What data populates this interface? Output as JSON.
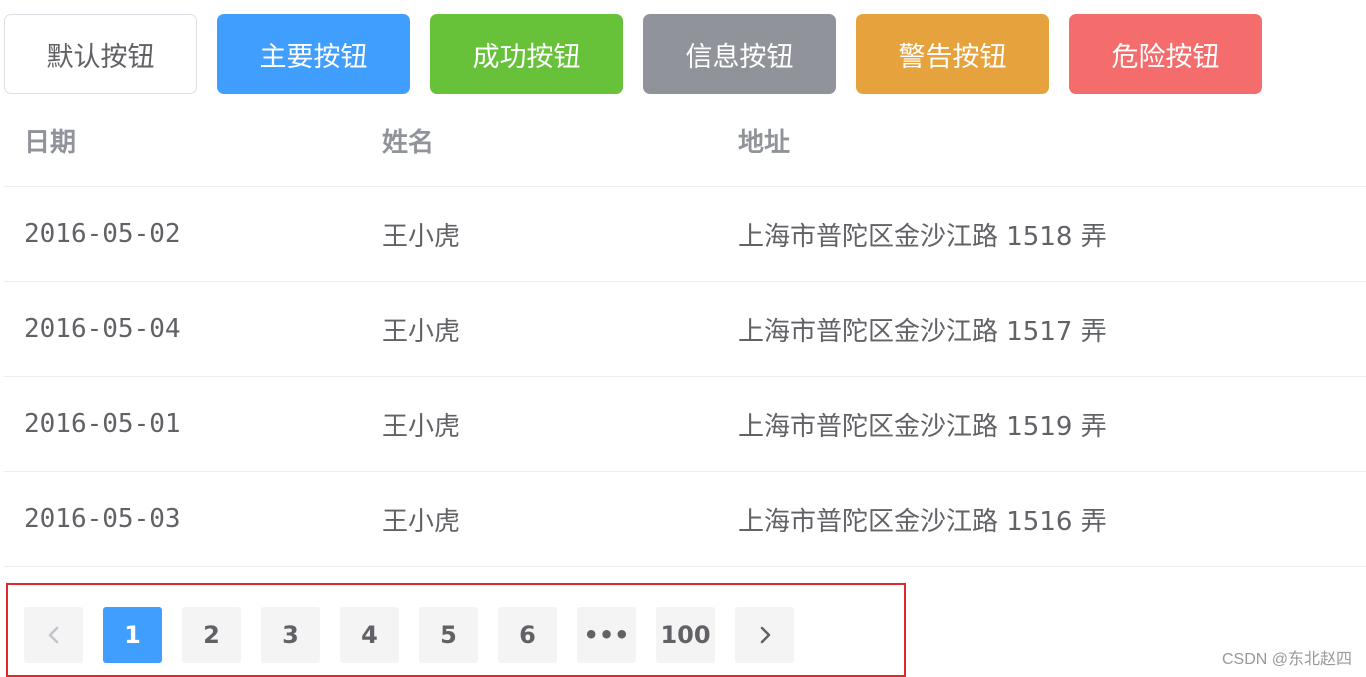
{
  "buttons": {
    "default": "默认按钮",
    "primary": "主要按钮",
    "success": "成功按钮",
    "info": "信息按钮",
    "warning": "警告按钮",
    "danger": "危险按钮"
  },
  "colors": {
    "primary": "#409eff",
    "success": "#67c23a",
    "info": "#909399",
    "warning": "#e6a23c",
    "danger": "#f56c6c",
    "highlight_border": "#e3262a"
  },
  "table": {
    "headers": [
      "日期",
      "姓名",
      "地址"
    ],
    "rows": [
      [
        "2016-05-02",
        "王小虎",
        "上海市普陀区金沙江路 1518 弄"
      ],
      [
        "2016-05-04",
        "王小虎",
        "上海市普陀区金沙江路 1517 弄"
      ],
      [
        "2016-05-01",
        "王小虎",
        "上海市普陀区金沙江路 1519 弄"
      ],
      [
        "2016-05-03",
        "王小虎",
        "上海市普陀区金沙江路 1516 弄"
      ]
    ]
  },
  "pagination": {
    "prev_icon": "chevron-left-icon",
    "pages": [
      "1",
      "2",
      "3",
      "4",
      "5",
      "6"
    ],
    "more": "•••",
    "last": "100",
    "next_icon": "chevron-right-icon",
    "current": "1"
  },
  "watermark": "CSDN @东北赵四"
}
